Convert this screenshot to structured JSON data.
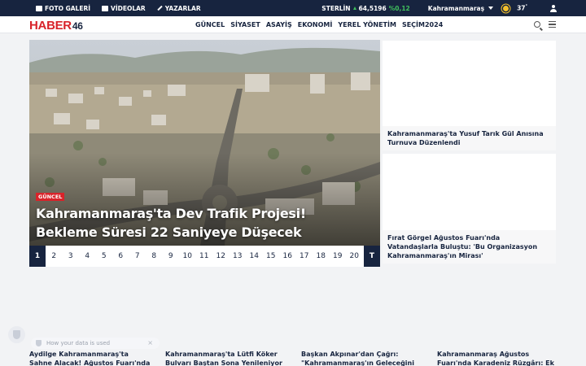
{
  "topbar": {
    "links": [
      {
        "label": "FOTO GALERİ",
        "icon": "camera-icon"
      },
      {
        "label": "VİDEOLAR",
        "icon": "video-icon"
      },
      {
        "label": "YAZARLAR",
        "icon": "pen-icon"
      }
    ],
    "currency_label": "STERLİN",
    "currency_value": "64,5196",
    "currency_change": "%0,12",
    "city": "Kahramanmaraş",
    "temperature": "37",
    "temperature_unit": "°"
  },
  "header": {
    "logo_text": "HABER",
    "logo_number": "46",
    "menu": [
      "GÜNCEL",
      "SİYASET",
      "ASAYİŞ",
      "EKONOMİ",
      "YEREL YÖNETİM",
      "SEÇİM2024"
    ]
  },
  "hero": {
    "category": "GÜNCEL",
    "title": "Kahramanmaraş'ta Dev Trafik Projesi! Bekleme Süresi 22 Saniyeye Düşecek",
    "pages": [
      "1",
      "2",
      "3",
      "4",
      "5",
      "6",
      "7",
      "8",
      "9",
      "10",
      "11",
      "12",
      "13",
      "14",
      "15",
      "16",
      "17",
      "18",
      "19",
      "20"
    ],
    "active_page": "1",
    "all_label": "T"
  },
  "side": [
    {
      "title": "Kahramanmaraş'ta Yusuf Tarık Gül Anısına Turnuva Düzenlendi"
    },
    {
      "title": "Fırat Görgel Ağustos Fuarı'nda Vatandaşlarla Buluştu: 'Bu Organizasyon Kahramanmaraş'ın Mirası'"
    }
  ],
  "bottom_news": [
    {
      "title": "Aydilge Kahramanmaraş'ta Sahne Alacak! Ağustos Fuarı'nda Müzi"
    },
    {
      "title": "Kahramanmaraş'ta Lütfi Köker Bulvarı Baştan Sona Yenileniyor"
    },
    {
      "title": "Başkan Akpınar'dan Çağrı: \"Kahramanmaraş'ın Geleceğini"
    },
    {
      "title": "Kahramanmaraş Ağustos Fuarı'nda Karadeniz Rüzgârı: Ek"
    }
  ],
  "cookie": {
    "text": "How your data is used",
    "close": "×"
  },
  "colors": {
    "navy": "#17243f",
    "brand_red": "#d8232a",
    "positive": "#3fbf5c"
  }
}
